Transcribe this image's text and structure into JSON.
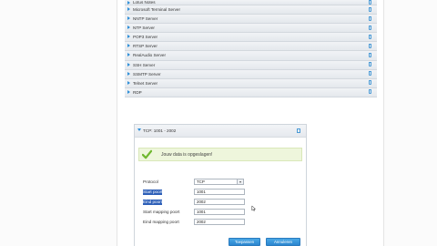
{
  "services": [
    {
      "label": "Lotus Notes"
    },
    {
      "label": "Microsoft Terminal Server"
    },
    {
      "label": "NNTP Server"
    },
    {
      "label": "NTP Server"
    },
    {
      "label": "POP3 Server"
    },
    {
      "label": "RTSP Server"
    },
    {
      "label": "RealAudio Server"
    },
    {
      "label": "SSH Server"
    },
    {
      "label": "SSMTP Server"
    },
    {
      "label": "Telnet Server"
    },
    {
      "label": "RDP"
    }
  ],
  "rule": {
    "title": "TCP: 1001 - 2002",
    "success_message": "Jouw data is opgeslagen!",
    "fields": {
      "protocol_label": "Protocol",
      "protocol_value": "TCP",
      "start_poort_label": "Start poort",
      "start_poort_value": "1001",
      "eind_poort_label": "Eind poort",
      "eind_poort_value": "2002",
      "start_mapping_label": "Start mapping poort",
      "start_mapping_value": "1001",
      "eind_mapping_label": "Eind mapping poort",
      "eind_mapping_value": "2002"
    },
    "save_label": "Toepassen",
    "cancel_label": "Annuleren"
  },
  "colors": {
    "accent": "#2f8fd8",
    "success_bg": "#eef6dc",
    "selection": "#2d5fb8"
  }
}
